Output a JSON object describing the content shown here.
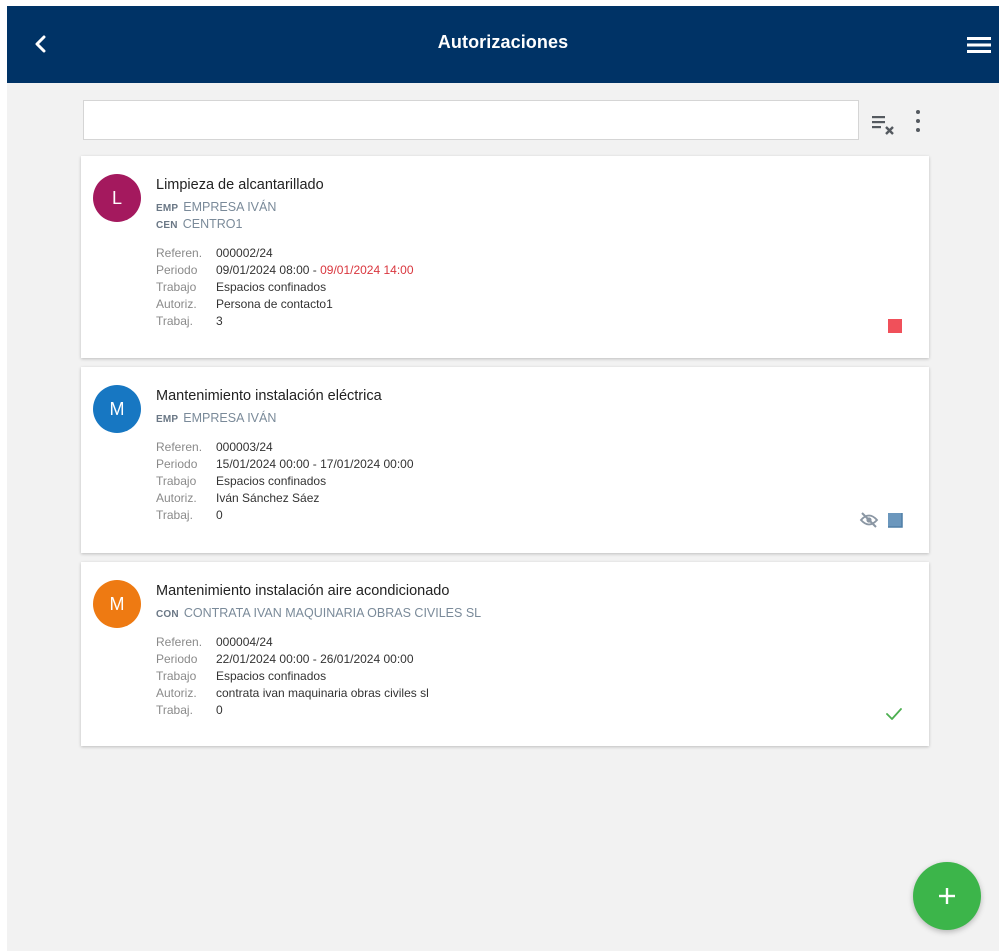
{
  "header": {
    "title": "Autorizaciones",
    "background": "#003366"
  },
  "search": {
    "value": "",
    "placeholder": ""
  },
  "labels": {
    "referencia": "Referen.",
    "periodo": "Periodo",
    "trabajo": "Trabajo",
    "autoriz": "Autoriz.",
    "trabajadores": "Trabaj."
  },
  "cards": [
    {
      "avatar_letter": "L",
      "avatar_color": "#a4195e",
      "title": "Limpieza de alcantarillado",
      "orgs": [
        {
          "code": "EMP",
          "name": "EMPRESA IVÁN"
        },
        {
          "code": "CEN",
          "name": "CENTRO1"
        }
      ],
      "referencia": "000002/24",
      "periodo_inicio": "09/01/2024 08:00",
      "periodo_sep": " - ",
      "periodo_fin": "09/01/2024 14:00",
      "trabajo": "Espacios confinados",
      "autoriz": "Persona de contacto1",
      "trabajadores": "3",
      "status_icons": [
        "red-square-icon"
      ],
      "status_color": "#f0505a"
    },
    {
      "avatar_letter": "M",
      "avatar_color": "#1777c2",
      "title": "Mantenimiento instalación eléctrica",
      "orgs": [
        {
          "code": "EMP",
          "name": "EMPRESA IVÁN"
        }
      ],
      "referencia": "000003/24",
      "periodo_inicio": "15/01/2024 00:00",
      "periodo_sep": " - ",
      "periodo_fin": "17/01/2024 00:00",
      "trabajo": "Espacios confinados",
      "autoriz": "Iván Sánchez Sáez",
      "trabajadores": "0",
      "status_icons": [
        "eye-off-icon",
        "blue-square-icon"
      ],
      "status_color": "#6b97bd"
    },
    {
      "avatar_letter": "M",
      "avatar_color": "#ee7a12",
      "title": "Mantenimiento instalación aire acondicionado",
      "orgs": [
        {
          "code": "CON",
          "name": "CONTRATA IVAN MAQUINARIA OBRAS CIVILES SL"
        }
      ],
      "referencia": "000004/24",
      "periodo_inicio": "22/01/2024 00:00",
      "periodo_sep": " - ",
      "periodo_fin": "26/01/2024 00:00",
      "trabajo": "Espacios confinados",
      "autoriz": "contrata ivan maquinaria obras civiles sl",
      "trabajadores": "0",
      "status_icons": [
        "check-icon"
      ],
      "status_color": "#4caf50"
    }
  ],
  "fab": {
    "icon": "plus-icon",
    "color": "#3cb54a"
  }
}
